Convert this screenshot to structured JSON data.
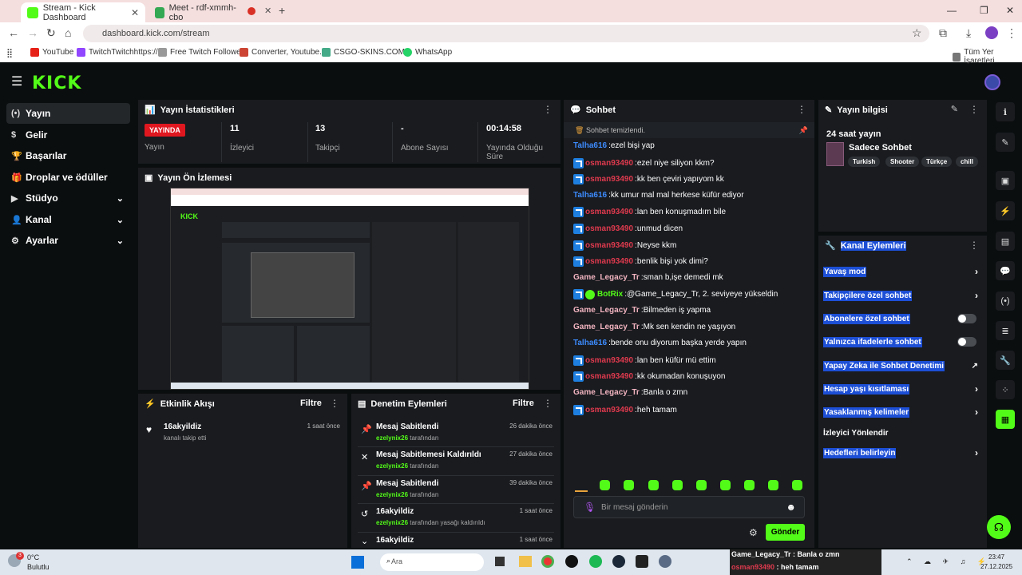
{
  "browser": {
    "tabs": [
      {
        "title": "Stream - Kick Dashboard"
      },
      {
        "title": "Meet - rdf-xmmh-cbo"
      }
    ],
    "url": "dashboard.kick.com/stream",
    "bookmarks": [
      "YouTube",
      "TwitchTwitchhttps://...",
      "Free Twitch Followe...",
      "Converter, Youtube...",
      "CSGO-SKINS.COM",
      "WhatsApp"
    ],
    "all_bookmarks": "Tüm Yer İşaretleri"
  },
  "kick": {
    "logo": "KICK",
    "nav": [
      {
        "label": "Yayın",
        "icon": "(•)"
      },
      {
        "label": "Gelir",
        "icon": "$"
      },
      {
        "label": "Başarılar",
        "icon": "🏆"
      },
      {
        "label": "Droplar ve ödüller",
        "icon": "🎁"
      },
      {
        "label": "Stüdyo",
        "icon": "▶"
      },
      {
        "label": "Kanal",
        "icon": "👤"
      },
      {
        "label": "Ayarlar",
        "icon": "⚙"
      }
    ],
    "stats": {
      "title": "Yayın İstatistikleri",
      "live_badge": "YAYINDA",
      "items": [
        {
          "value": "",
          "label": "Yayın"
        },
        {
          "value": "11",
          "label": "İzleyici"
        },
        {
          "value": "13",
          "label": "Takipçi"
        },
        {
          "value": "-",
          "label": "Abone Sayısı"
        },
        {
          "value": "00:14:58",
          "label": "Yayında Olduğu Süre"
        }
      ]
    },
    "preview": {
      "title": "Yayın Ön İzlemesi"
    },
    "activity": {
      "title": "Etkinlik Akışı",
      "filter": "Filtre",
      "events": [
        {
          "title": "16akyildiz",
          "sub": "kanalı takip etti",
          "time": "1 saat önce"
        }
      ]
    },
    "moderation": {
      "title": "Denetim Eylemleri",
      "filter": "Filtre",
      "events": [
        {
          "title": "Mesaj Sabitlendi",
          "user": "ezelynix26",
          "sub": " tarafından",
          "time": "26 dakika önce"
        },
        {
          "title": "Mesaj Sabitlemesi Kaldırıldı",
          "user": "ezelynix26",
          "sub": " tarafından",
          "time": "27 dakika önce"
        },
        {
          "title": "Mesaj Sabitlendi",
          "user": "ezelynix26",
          "sub": " tarafından",
          "time": "39 dakika önce"
        },
        {
          "title": "16akyildiz",
          "user": "ezelynix26",
          "sub": " tarafından yasağı kaldırıldı",
          "time": "1 saat önce"
        },
        {
          "title": "16akyildiz",
          "user": "",
          "sub": "",
          "time": "1 saat önce"
        }
      ]
    },
    "chat": {
      "title": "Sohbet",
      "cleared": "Sohbet temizlendi.",
      "messages": [
        {
          "user": "Talha616",
          "color": "#3d8bfd",
          "badge": false,
          "text": "ezel bişi yap"
        },
        {
          "user": "osman93490",
          "color": "#e03a4e",
          "badge": true,
          "text": "ezel niye siliyon kkm?"
        },
        {
          "user": "osman93490",
          "color": "#e03a4e",
          "badge": true,
          "text": "kk ben çeviri yapıyom kk"
        },
        {
          "user": "Talha616",
          "color": "#3d8bfd",
          "badge": false,
          "text": "kk umur mal mal herkese küfür ediyor"
        },
        {
          "user": "osman93490",
          "color": "#e03a4e",
          "badge": true,
          "text": "lan ben konuşmadım bile"
        },
        {
          "user": "osman93490",
          "color": "#e03a4e",
          "badge": true,
          "text": "unmud dicen"
        },
        {
          "user": "osman93490",
          "color": "#e03a4e",
          "badge": true,
          "text": "Neyse kkm"
        },
        {
          "user": "osman93490",
          "color": "#e03a4e",
          "badge": true,
          "text": "benlik bişi yok dimi?"
        },
        {
          "user": "Game_Legacy_Tr",
          "color": "#f2b4c0",
          "badge": false,
          "text": "sman b,işe demedi mk"
        },
        {
          "user": "BotRix",
          "color": "#53fc18",
          "badge": true,
          "text": "@Game_Legacy_Tr, 2. seviyeye yükseldin"
        },
        {
          "user": "Game_Legacy_Tr",
          "color": "#f2b4c0",
          "badge": false,
          "text": "Bilmeden iş yapma"
        },
        {
          "user": "Game_Legacy_Tr",
          "color": "#f2b4c0",
          "badge": false,
          "text": "Mk sen kendin ne yaşıyon"
        },
        {
          "user": "Talha616",
          "color": "#3d8bfd",
          "badge": false,
          "text": "bende onu diyorum başka yerde yapın"
        },
        {
          "user": "osman93490",
          "color": "#e03a4e",
          "badge": true,
          "text": "lan ben küfür mü ettim"
        },
        {
          "user": "osman93490",
          "color": "#e03a4e",
          "badge": true,
          "text": "kk okumadan konuşuyon"
        },
        {
          "user": "Game_Legacy_Tr",
          "color": "#f2b4c0",
          "badge": false,
          "text": "Banla o zmn"
        },
        {
          "user": "osman93490",
          "color": "#e03a4e",
          "badge": true,
          "text": "heh tamam"
        }
      ],
      "input_placeholder": "Bir mesaj gönderin",
      "send": "Gönder"
    },
    "stream_info": {
      "title": "Yayın bilgisi",
      "heading": "24 saat yayın",
      "category": "Sadece Sohbet",
      "tags": [
        "Turkish",
        "Shooter",
        "Türkçe",
        "chill"
      ]
    },
    "channel_actions": {
      "title": "Kanal Eylemleri",
      "items": [
        {
          "label": "Yavaş mod",
          "control": "arrow"
        },
        {
          "label": "Takipçilere özel sohbet",
          "control": "arrow"
        },
        {
          "label": "Abonelere özel sohbet",
          "control": "toggle"
        },
        {
          "label": "Yalnızca ifadelerle sohbet",
          "control": "toggle"
        },
        {
          "label": "Yapay Zeka ile Sohbet Denetimi",
          "control": "external"
        },
        {
          "label": "Hesap yaşı kısıtlaması",
          "control": "arrow"
        },
        {
          "label": "Yasaklanmış kelimeler",
          "control": "arrow"
        },
        {
          "label": "İzleyici Yönlendir",
          "control": "none"
        },
        {
          "label": "Hedefleri belirleyin",
          "control": "arrow"
        }
      ]
    }
  },
  "taskbar": {
    "weather_temp": "0°C",
    "weather_desc": "Bulutlu",
    "search": "Ara",
    "notif_1_user": "Game_Legacy_Tr",
    "notif_1_text": " : Banla o zmn",
    "notif_2_user": "osman93490",
    "notif_2_text": " : heh tamam",
    "time": "23:47",
    "date": "27.12.2025",
    "weather_badge": "3"
  },
  "colors": {
    "kick_green": "#53fc18",
    "panel": "#191b1f",
    "bg": "#0b0e0f",
    "live_red": "#e0171f"
  }
}
